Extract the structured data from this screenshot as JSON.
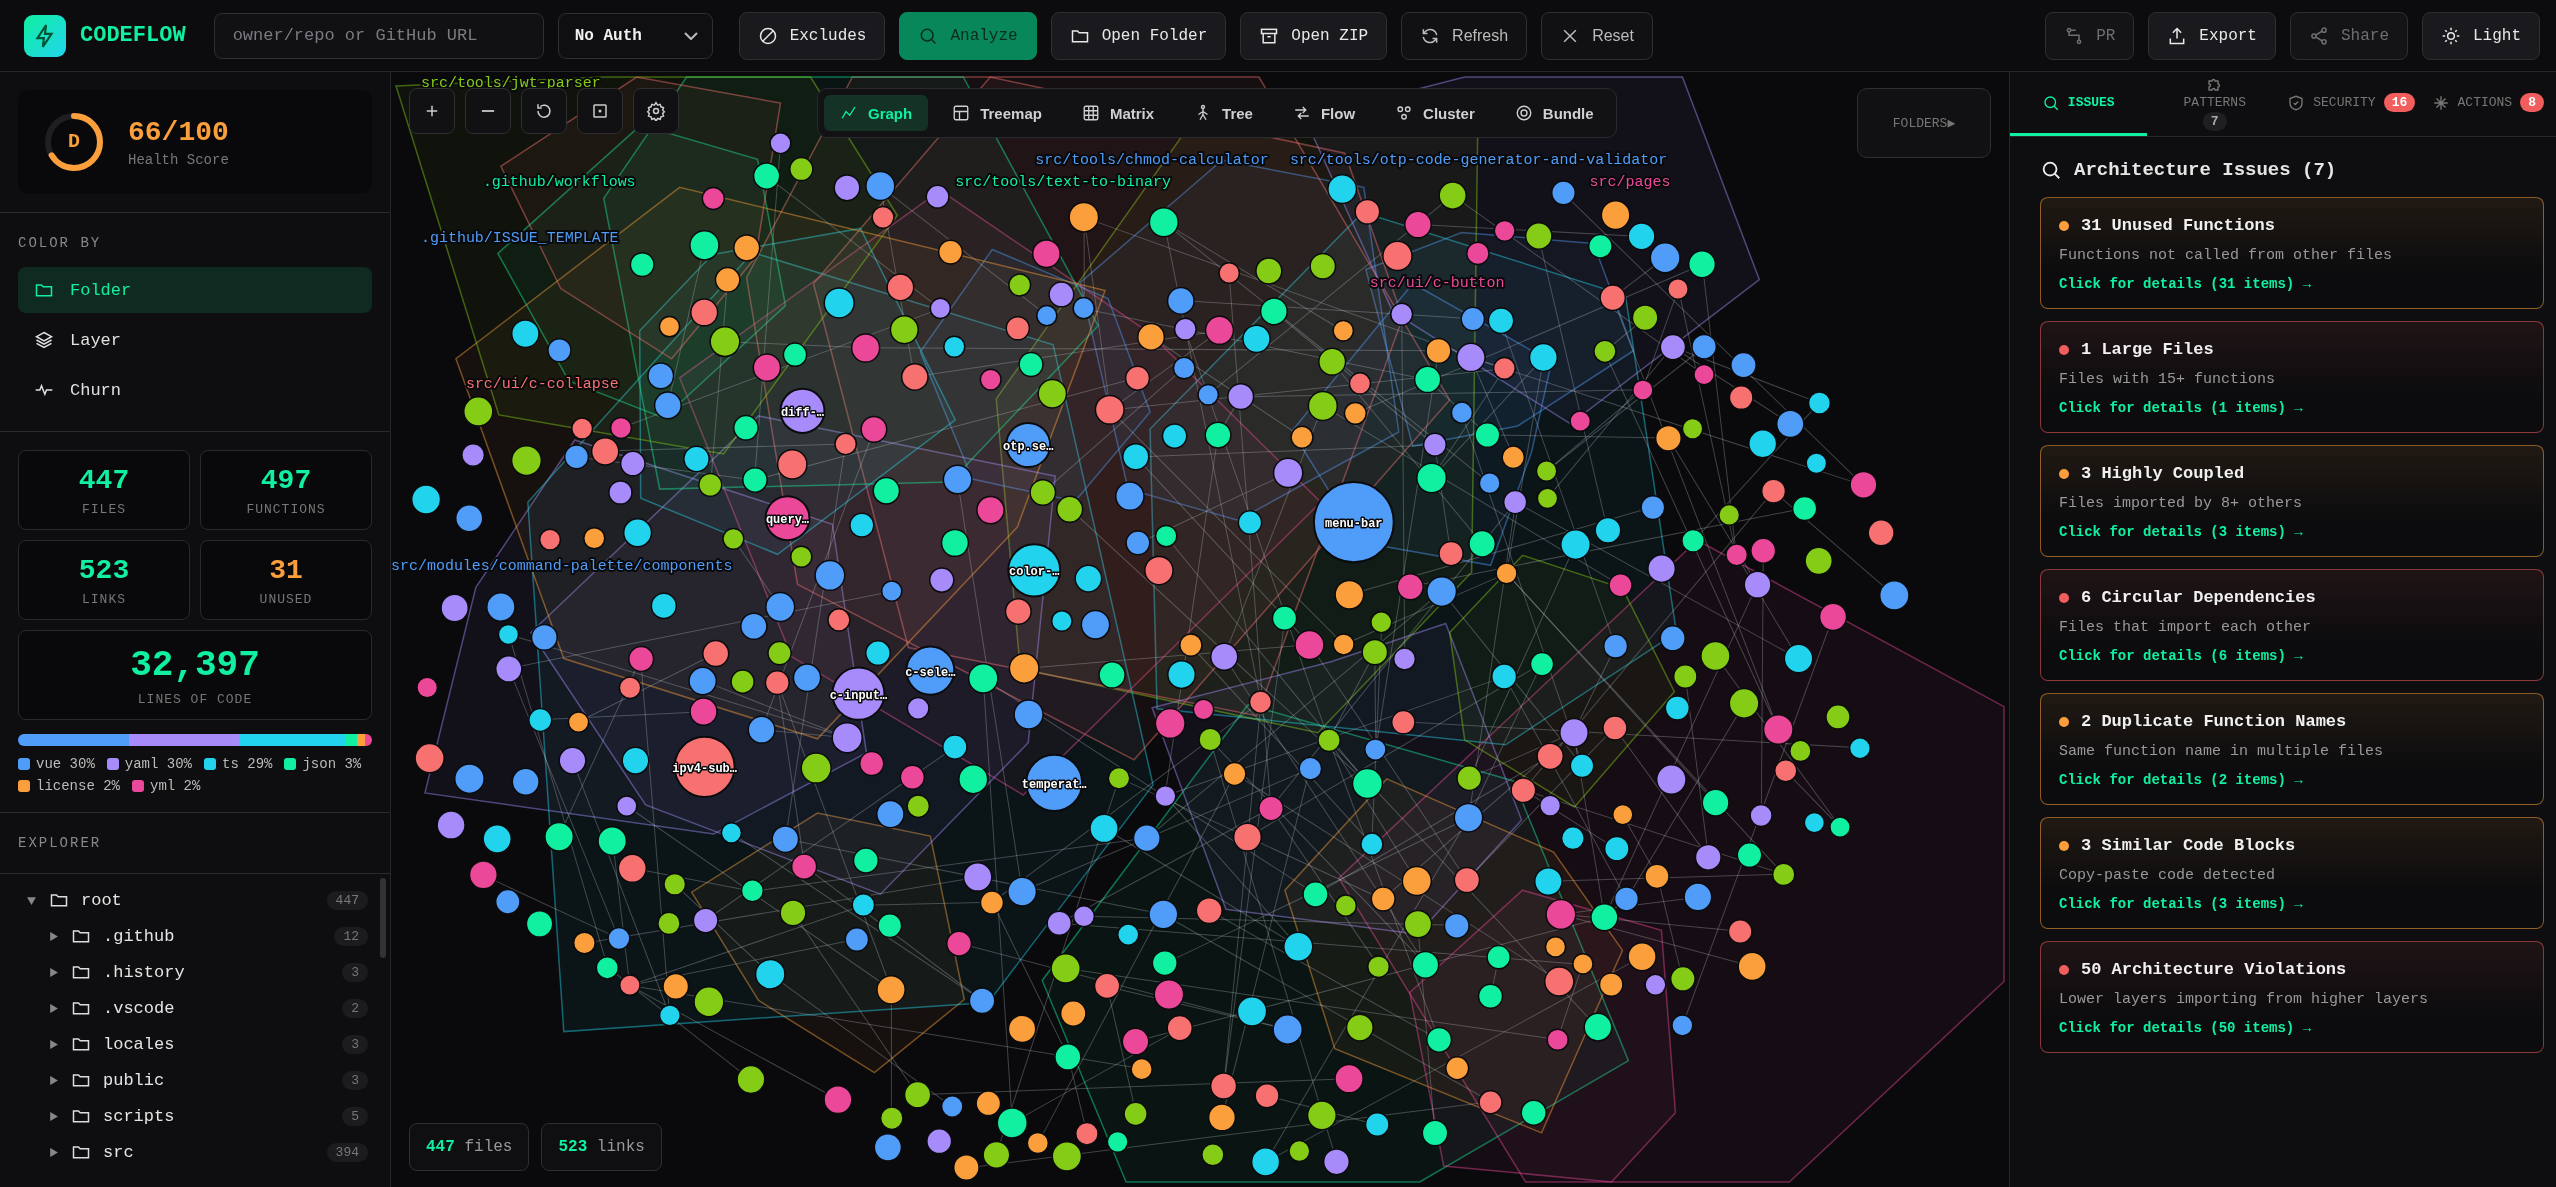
{
  "brand": {
    "name": "CODEFLOW"
  },
  "toolbar": {
    "repo_placeholder": "owner/repo or GitHub URL",
    "auth": "No Auth",
    "left_buttons": [
      {
        "label": "Excludes",
        "kind": "excludes",
        "primary": false
      },
      {
        "label": "Analyze",
        "kind": "search",
        "primary": true
      },
      {
        "label": "Open Folder",
        "kind": "folder",
        "primary": false
      },
      {
        "label": "Open ZIP",
        "kind": "archive",
        "primary": false
      },
      {
        "label": "Refresh",
        "kind": "refresh",
        "primary": false
      },
      {
        "label": "Reset",
        "kind": "close",
        "primary": false
      }
    ],
    "right_buttons": [
      {
        "label": "PR",
        "kind": "branch",
        "disabled": true
      },
      {
        "label": "Export",
        "kind": "upload",
        "disabled": false
      },
      {
        "label": "Share",
        "kind": "share",
        "disabled": true
      },
      {
        "label": "Light",
        "kind": "sun",
        "disabled": false
      }
    ]
  },
  "sidebar": {
    "health": {
      "grade": "D",
      "score": "66/100",
      "label": "Health Score",
      "level": 0.66
    },
    "color_by": {
      "title": "COLOR BY",
      "options": [
        {
          "label": "Folder",
          "kind": "folder",
          "selected": true
        },
        {
          "label": "Layer",
          "kind": "layers",
          "selected": false
        },
        {
          "label": "Churn",
          "kind": "pulse",
          "selected": false
        }
      ]
    },
    "stats": [
      {
        "value": "447",
        "label": "FILES",
        "warning": false
      },
      {
        "value": "497",
        "label": "FUNCTIONS",
        "warning": false
      },
      {
        "value": "523",
        "label": "LINKS",
        "warning": false
      },
      {
        "value": "31",
        "label": "UNUSED",
        "warning": true
      },
      {
        "value": "32,397",
        "label": "LINES OF CODE",
        "warning": false
      }
    ],
    "languages": [
      {
        "name": "vue",
        "share": "30%",
        "color": "#4f9cf9"
      },
      {
        "name": "yaml",
        "share": "30%",
        "color": "#a78bfa"
      },
      {
        "name": "ts",
        "share": "29%",
        "color": "#22d3ee"
      },
      {
        "name": "json",
        "share": "3%",
        "color": "#10f0a0"
      },
      {
        "name": "license",
        "share": "2%",
        "color": "#fb9f3c"
      },
      {
        "name": "yml",
        "share": "2%",
        "color": "#ec4899"
      }
    ],
    "explorer": {
      "title": "EXPLORER",
      "tree": [
        {
          "name": "root",
          "count": "447",
          "expanded": true,
          "children": [
            {
              "name": ".github",
              "count": "12",
              "expanded": false
            },
            {
              "name": ".history",
              "count": "3",
              "expanded": false
            },
            {
              "name": ".vscode",
              "count": "2",
              "expanded": false
            },
            {
              "name": "locales",
              "count": "3",
              "expanded": false
            },
            {
              "name": "public",
              "count": "3",
              "expanded": false
            },
            {
              "name": "scripts",
              "count": "5",
              "expanded": false
            },
            {
              "name": "src",
              "count": "394",
              "expanded": false
            }
          ]
        }
      ]
    }
  },
  "graph": {
    "views": [
      {
        "label": "Graph",
        "kind": "graph",
        "selected": true
      },
      {
        "label": "Treemap",
        "kind": "treemap",
        "selected": false
      },
      {
        "label": "Matrix",
        "kind": "matrix",
        "selected": false
      },
      {
        "label": "Tree",
        "kind": "tree",
        "selected": false
      },
      {
        "label": "Flow",
        "kind": "flow",
        "selected": false
      },
      {
        "label": "Cluster",
        "kind": "cluster",
        "selected": false
      },
      {
        "label": "Bundle",
        "kind": "bundle",
        "selected": false
      }
    ],
    "folders_toggle": "FOLDERS▶",
    "folder_labels": [
      "src/tools/jwt-parser",
      "src/tools/chmod-calculator",
      "src/tools/otp-code-generator-and-validator",
      ".github/workflows",
      "src/tools/text-to-binary",
      "src/pages",
      ".github/ISSUE_TEMPLATE",
      "src/ui/c-button",
      "src/ui/c-collapse",
      "src/modules/command-palette/components"
    ],
    "nodes": [
      {
        "label": "menu-bar",
        "color": "#4f9cf9"
      },
      {
        "label": "ipv4-sub…",
        "color": "#f87171"
      },
      {
        "label": "temperat…",
        "color": "#4f9cf9"
      },
      {
        "label": "c-input…",
        "color": "#a78bfa"
      },
      {
        "label": "color-…",
        "color": "#22d3ee"
      },
      {
        "label": "query…",
        "color": "#ec4899"
      },
      {
        "label": "c-sele…",
        "color": "#4f9cf9"
      },
      {
        "label": "otp.se…",
        "color": "#4f9cf9"
      },
      {
        "label": "diff-…",
        "color": "#a78bfa"
      }
    ],
    "counts": [
      {
        "value": "447",
        "unit": "files"
      },
      {
        "value": "523",
        "unit": "links"
      }
    ]
  },
  "panel": {
    "tabs": [
      {
        "label": "ISSUES",
        "kind": "search",
        "selected": true
      },
      {
        "label": "PATTERNS",
        "kind": "puzzle",
        "selected": false,
        "badge": "7",
        "alert": false
      },
      {
        "label": "SECURITY",
        "kind": "shield",
        "selected": false,
        "badge": "16",
        "alert": true
      },
      {
        "label": "ACTIONS",
        "kind": "spark",
        "selected": false,
        "badge": "8",
        "alert": true
      }
    ],
    "heading": "Architecture Issues (7)",
    "issues": [
      {
        "title": "31 Unused Functions",
        "description": "Functions not called from other files",
        "link": "Click for details (31 items) →",
        "color": "#fb9f3c"
      },
      {
        "title": "1 Large Files",
        "description": "Files with 15+ functions",
        "link": "Click for details (1 items) →",
        "color": "#f25d5d"
      },
      {
        "title": "3 Highly Coupled",
        "description": "Files imported by 8+ others",
        "link": "Click for details (3 items) →",
        "color": "#fb9f3c"
      },
      {
        "title": "6 Circular Dependencies",
        "description": "Files that import each other",
        "link": "Click for details (6 items) →",
        "color": "#f25d5d"
      },
      {
        "title": "2 Duplicate Function Names",
        "description": "Same function name in multiple files",
        "link": "Click for details (2 items) →",
        "color": "#fb9f3c"
      },
      {
        "title": "3 Similar Code Blocks",
        "description": "Copy-paste code detected",
        "link": "Click for details (3 items) →",
        "color": "#fb9f3c"
      },
      {
        "title": "50 Architecture Violations",
        "description": "Lower layers importing from higher layers",
        "link": "Click for details (50 items) →",
        "color": "#f25d5d"
      }
    ]
  }
}
